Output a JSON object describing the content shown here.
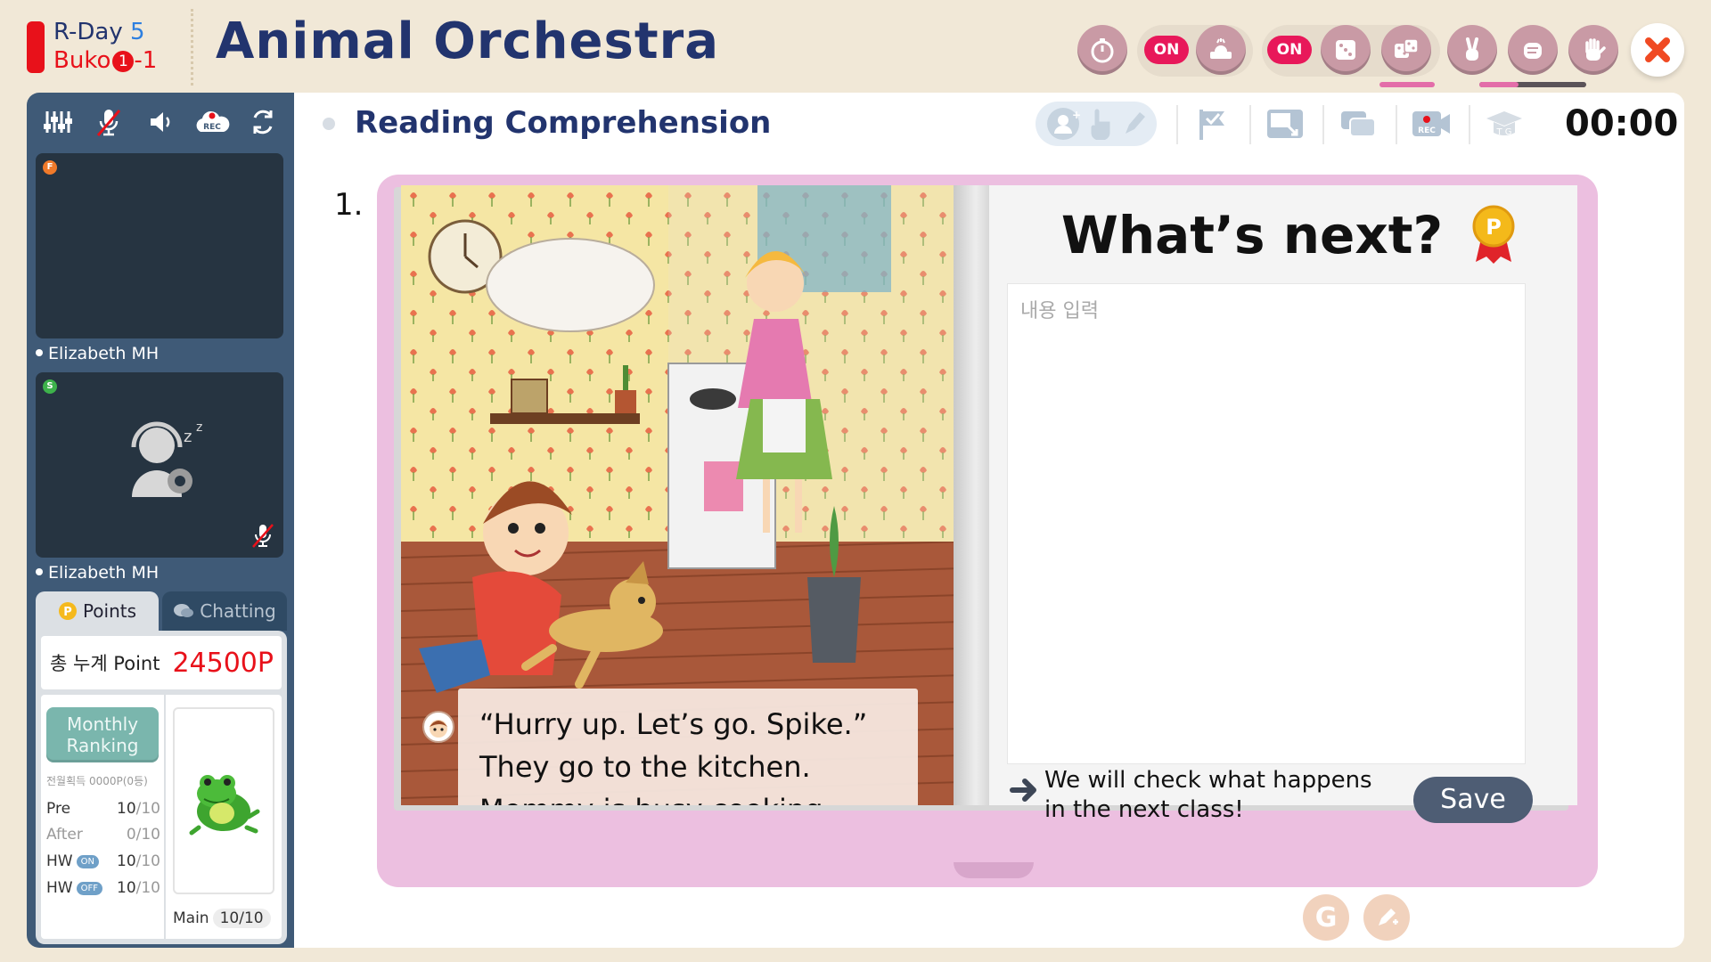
{
  "header": {
    "day_label": "R-Day",
    "day_number": "5",
    "course_name": "Buko",
    "course_level": "1",
    "course_suffix": "-1",
    "title": "Animal Orchestra",
    "toggle_1": "ON",
    "toggle_2": "ON",
    "icons": [
      "stopwatch-icon",
      "buzzer-icon",
      "dice-icon",
      "two-dice-icon",
      "peace-hand-icon",
      "fist-icon",
      "open-hand-icon",
      "close-icon"
    ],
    "accent_color": "#22346e",
    "button_color": "#c99aa5",
    "on_color": "#e8185a"
  },
  "sidebar": {
    "tools": [
      "equalizer-icon",
      "mic-muted-icon",
      "speaker-icon",
      "rec-icon",
      "switch-icon"
    ],
    "rec_label": "REC",
    "participants": [
      {
        "name": "Elizabeth MH",
        "badge": "F",
        "badge_color": "#f07a2a"
      },
      {
        "name": "Elizabeth MH",
        "badge": "S",
        "badge_color": "#3db24b"
      }
    ],
    "tabs": {
      "points": "Points",
      "chatting": "Chatting"
    },
    "total_label": "총 누계 Point",
    "total_value": "24500",
    "total_unit": "P",
    "ranking_label_1": "Monthly",
    "ranking_label_2": "Ranking",
    "last_month": "전월획득 0000P(0등)",
    "scores": [
      {
        "label": "Pre",
        "value": "10",
        "total": "/10"
      },
      {
        "label": "After",
        "value": "0",
        "total": "/10"
      },
      {
        "label": "HW",
        "tag": "ON",
        "value": "10",
        "total": "/10"
      },
      {
        "label": "HW",
        "tag": "OFF",
        "value": "10",
        "total": "/10"
      }
    ],
    "main_label": "Main",
    "main_value": "10/10"
  },
  "main": {
    "section_title": "Reading Comprehension",
    "timer": "00:00",
    "rec_label": "REC",
    "tg_label": "T G",
    "question_number": "1.",
    "story_lines": [
      "“Hurry up. Let’s go. Spike.”",
      "They go to the kitchen.",
      "Mommy is busy cooking."
    ],
    "prompt_title": "What’s next?",
    "medal_letter": "P",
    "answer_placeholder": "내용 입력",
    "hint_line_1": "We will check what happens",
    "hint_line_2": "in the next class!",
    "save_label": "Save",
    "g_label": "G"
  }
}
